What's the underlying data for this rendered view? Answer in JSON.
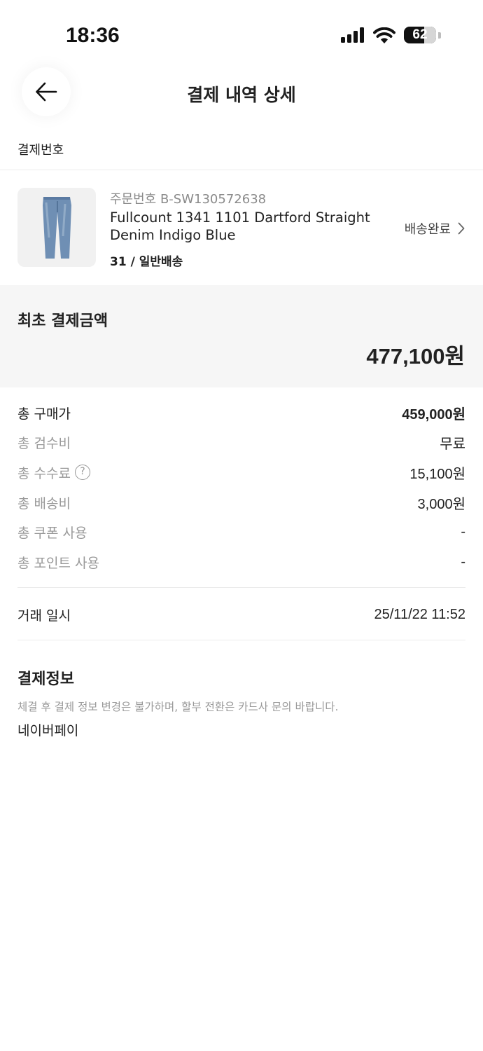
{
  "status_bar": {
    "time": "18:36",
    "battery": "62",
    "battery_level": 0.62
  },
  "header": {
    "title": "결제 내역 상세",
    "back_icon": "arrow-left-icon"
  },
  "payment_number_label": "결제번호",
  "product": {
    "order_number": "주문번호 B-SW130572638",
    "name": "Fullcount 1341 1101 Dartford Straight Denim Indigo Blue",
    "option": "31 / 일반배송",
    "status": "배송완료",
    "image_icon": "jeans-thumbnail"
  },
  "total": {
    "label": "최초 결제금액",
    "value": "477,100원"
  },
  "breakdown": [
    {
      "label": "총 구매가",
      "value": "459,000원"
    },
    {
      "label": "총 검수비",
      "value": "무료"
    },
    {
      "label": "총 수수료",
      "value": "15,100원"
    },
    {
      "label": "총 배송비",
      "value": "3,000원"
    },
    {
      "label": "총 쿠폰 사용",
      "value": "-"
    },
    {
      "label": "총 포인트 사용",
      "value": "-"
    }
  ],
  "transaction": {
    "label": "거래 일시",
    "value": "25/11/22 11:52"
  },
  "payment_info": {
    "title": "결제정보",
    "note": "체결 후 결제 정보 변경은 불가하며, 할부 전환은 카드사 문의 바랍니다.",
    "method": "네이버페이"
  },
  "colors": {
    "muted": "#999999",
    "text": "#222222",
    "total_bg": "#f6f6f6",
    "divider": "#ebebeb"
  }
}
